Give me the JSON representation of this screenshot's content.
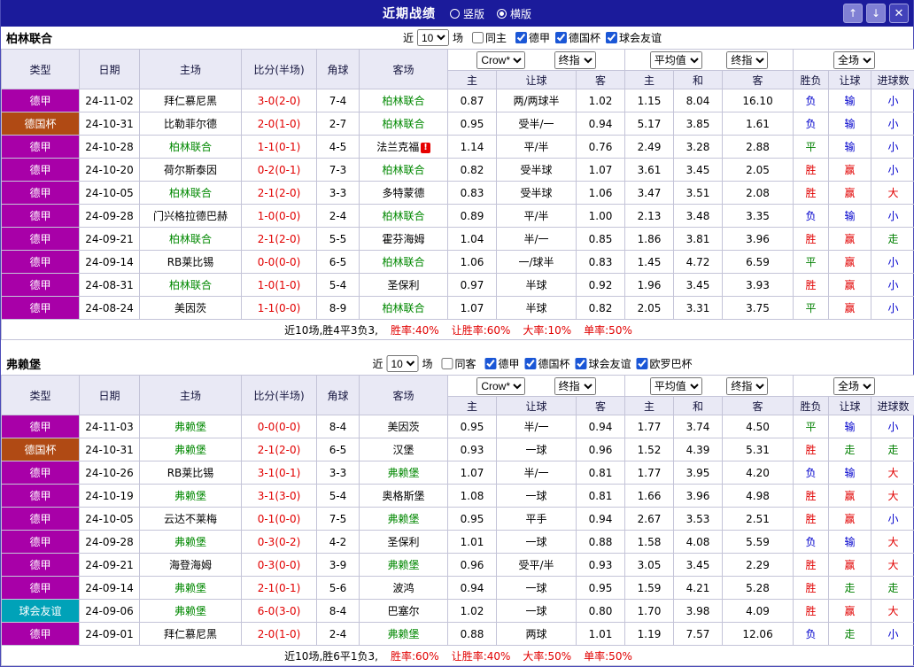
{
  "topbar": {
    "title": "近期战绩",
    "view_options": [
      {
        "label": "竖版",
        "selected": false
      },
      {
        "label": "横版",
        "selected": true
      }
    ],
    "background": "#1b1b9b"
  },
  "icons": {
    "up-icon": "↑",
    "down-icon": "↓",
    "close-icon": "✕",
    "alert-icon": "!"
  },
  "columns": [
    "类型",
    "日期",
    "主场",
    "比分(半场)",
    "角球",
    "客场",
    "主",
    "让球",
    "客",
    "主",
    "和",
    "客",
    "胜负",
    "让球",
    "进球数"
  ],
  "selects": {
    "handicap_company": "Crow*",
    "handicap_final": "终指",
    "euro_company": "平均值",
    "euro_final": "终指",
    "scope": "全场"
  },
  "league_colors": {
    "德甲": "#a800a8",
    "德国杯": "#b04a14",
    "球会友谊": "#00a2b8"
  },
  "result_colors": {
    "胜": "#e10000",
    "赢": "#e10000",
    "大": "#e10000",
    "负": "#0000cc",
    "输": "#0000cc",
    "小": "#0000cc",
    "平": "#008000",
    "走": "#008000"
  },
  "focus_color": "#008800",
  "score_color": "#e10000",
  "sections": [
    {
      "team": "柏林联合",
      "filter": {
        "near": "近",
        "count": "10",
        "unit": "场",
        "same": "同主",
        "leagues": [
          "德甲",
          "德国杯",
          "球会友谊"
        ]
      },
      "summary": {
        "prefix": "近10场,胜4平3负3,",
        "stats": [
          "胜率:40%",
          "让胜率:60%",
          "大率:10%",
          "单率:50%"
        ]
      },
      "rows": [
        {
          "league": "德甲",
          "date": "24-11-02",
          "home": "拜仁慕尼黑",
          "home_focus": false,
          "score": "3-0(2-0)",
          "corner": "7-4",
          "away": "柏林联合",
          "away_focus": true,
          "ah_home": "0.87",
          "handicap": "两/两球半",
          "ah_away": "1.02",
          "eu_home": "1.15",
          "eu_draw": "8.04",
          "eu_away": "16.10",
          "outcome": "负",
          "handicap_result": "输",
          "goals_result": "小"
        },
        {
          "league": "德国杯",
          "date": "24-10-31",
          "home": "比勒菲尔德",
          "home_focus": false,
          "score": "2-0(1-0)",
          "corner": "2-7",
          "away": "柏林联合",
          "away_focus": true,
          "ah_home": "0.95",
          "handicap": "受半/一",
          "ah_away": "0.94",
          "eu_home": "5.17",
          "eu_draw": "3.85",
          "eu_away": "1.61",
          "outcome": "负",
          "handicap_result": "输",
          "goals_result": "小"
        },
        {
          "league": "德甲",
          "date": "24-10-28",
          "home": "柏林联合",
          "home_focus": true,
          "score": "1-1(0-1)",
          "corner": "4-5",
          "away": "法兰克福",
          "away_focus": false,
          "away_alert": true,
          "ah_home": "1.14",
          "handicap": "平/半",
          "ah_away": "0.76",
          "eu_home": "2.49",
          "eu_draw": "3.28",
          "eu_away": "2.88",
          "outcome": "平",
          "handicap_result": "输",
          "goals_result": "小"
        },
        {
          "league": "德甲",
          "date": "24-10-20",
          "home": "荷尔斯泰因",
          "home_focus": false,
          "score": "0-2(0-1)",
          "corner": "7-3",
          "away": "柏林联合",
          "away_focus": true,
          "ah_home": "0.82",
          "handicap": "受半球",
          "ah_away": "1.07",
          "eu_home": "3.61",
          "eu_draw": "3.45",
          "eu_away": "2.05",
          "outcome": "胜",
          "handicap_result": "赢",
          "goals_result": "小"
        },
        {
          "league": "德甲",
          "date": "24-10-05",
          "home": "柏林联合",
          "home_focus": true,
          "score": "2-1(2-0)",
          "corner": "3-3",
          "away": "多特蒙德",
          "away_focus": false,
          "ah_home": "0.83",
          "handicap": "受半球",
          "ah_away": "1.06",
          "eu_home": "3.47",
          "eu_draw": "3.51",
          "eu_away": "2.08",
          "outcome": "胜",
          "handicap_result": "赢",
          "goals_result": "大"
        },
        {
          "league": "德甲",
          "date": "24-09-28",
          "home": "门兴格拉德巴赫",
          "home_focus": false,
          "score": "1-0(0-0)",
          "corner": "2-4",
          "away": "柏林联合",
          "away_focus": true,
          "ah_home": "0.89",
          "handicap": "平/半",
          "ah_away": "1.00",
          "eu_home": "2.13",
          "eu_draw": "3.48",
          "eu_away": "3.35",
          "outcome": "负",
          "handicap_result": "输",
          "goals_result": "小"
        },
        {
          "league": "德甲",
          "date": "24-09-21",
          "home": "柏林联合",
          "home_focus": true,
          "score": "2-1(2-0)",
          "corner": "5-5",
          "away": "霍芬海姆",
          "away_focus": false,
          "ah_home": "1.04",
          "handicap": "半/一",
          "ah_away": "0.85",
          "eu_home": "1.86",
          "eu_draw": "3.81",
          "eu_away": "3.96",
          "outcome": "胜",
          "handicap_result": "赢",
          "goals_result": "走"
        },
        {
          "league": "德甲",
          "date": "24-09-14",
          "home": "RB莱比锡",
          "home_focus": false,
          "score": "0-0(0-0)",
          "corner": "6-5",
          "away": "柏林联合",
          "away_focus": true,
          "ah_home": "1.06",
          "handicap": "一/球半",
          "ah_away": "0.83",
          "eu_home": "1.45",
          "eu_draw": "4.72",
          "eu_away": "6.59",
          "outcome": "平",
          "handicap_result": "赢",
          "goals_result": "小"
        },
        {
          "league": "德甲",
          "date": "24-08-31",
          "home": "柏林联合",
          "home_focus": true,
          "score": "1-0(1-0)",
          "corner": "5-4",
          "away": "圣保利",
          "away_focus": false,
          "ah_home": "0.97",
          "handicap": "半球",
          "ah_away": "0.92",
          "eu_home": "1.96",
          "eu_draw": "3.45",
          "eu_away": "3.93",
          "outcome": "胜",
          "handicap_result": "赢",
          "goals_result": "小"
        },
        {
          "league": "德甲",
          "date": "24-08-24",
          "home": "美因茨",
          "home_focus": false,
          "score": "1-1(0-0)",
          "corner": "8-9",
          "away": "柏林联合",
          "away_focus": true,
          "ah_home": "1.07",
          "handicap": "半球",
          "ah_away": "0.82",
          "eu_home": "2.05",
          "eu_draw": "3.31",
          "eu_away": "3.75",
          "outcome": "平",
          "handicap_result": "赢",
          "goals_result": "小"
        }
      ]
    },
    {
      "team": "弗赖堡",
      "filter": {
        "near": "近",
        "count": "10",
        "unit": "场",
        "same": "同客",
        "leagues": [
          "德甲",
          "德国杯",
          "球会友谊",
          "欧罗巴杯"
        ]
      },
      "summary": {
        "prefix": "近10场,胜6平1负3,",
        "stats": [
          "胜率:60%",
          "让胜率:40%",
          "大率:50%",
          "单率:50%"
        ]
      },
      "rows": [
        {
          "league": "德甲",
          "date": "24-11-03",
          "home": "弗赖堡",
          "home_focus": true,
          "score": "0-0(0-0)",
          "corner": "8-4",
          "away": "美因茨",
          "away_focus": false,
          "ah_home": "0.95",
          "handicap": "半/一",
          "ah_away": "0.94",
          "eu_home": "1.77",
          "eu_draw": "3.74",
          "eu_away": "4.50",
          "outcome": "平",
          "handicap_result": "输",
          "goals_result": "小"
        },
        {
          "league": "德国杯",
          "date": "24-10-31",
          "home": "弗赖堡",
          "home_focus": true,
          "score": "2-1(2-0)",
          "corner": "6-5",
          "away": "汉堡",
          "away_focus": false,
          "ah_home": "0.93",
          "handicap": "一球",
          "ah_away": "0.96",
          "eu_home": "1.52",
          "eu_draw": "4.39",
          "eu_away": "5.31",
          "outcome": "胜",
          "handicap_result": "走",
          "goals_result": "走"
        },
        {
          "league": "德甲",
          "date": "24-10-26",
          "home": "RB莱比锡",
          "home_focus": false,
          "score": "3-1(0-1)",
          "corner": "3-3",
          "away": "弗赖堡",
          "away_focus": true,
          "ah_home": "1.07",
          "handicap": "半/一",
          "ah_away": "0.81",
          "eu_home": "1.77",
          "eu_draw": "3.95",
          "eu_away": "4.20",
          "outcome": "负",
          "handicap_result": "输",
          "goals_result": "大"
        },
        {
          "league": "德甲",
          "date": "24-10-19",
          "home": "弗赖堡",
          "home_focus": true,
          "score": "3-1(3-0)",
          "corner": "5-4",
          "away": "奥格斯堡",
          "away_focus": false,
          "ah_home": "1.08",
          "handicap": "一球",
          "ah_away": "0.81",
          "eu_home": "1.66",
          "eu_draw": "3.96",
          "eu_away": "4.98",
          "outcome": "胜",
          "handicap_result": "赢",
          "goals_result": "大"
        },
        {
          "league": "德甲",
          "date": "24-10-05",
          "home": "云达不莱梅",
          "home_focus": false,
          "score": "0-1(0-0)",
          "corner": "7-5",
          "away": "弗赖堡",
          "away_focus": true,
          "ah_home": "0.95",
          "handicap": "平手",
          "ah_away": "0.94",
          "eu_home": "2.67",
          "eu_draw": "3.53",
          "eu_away": "2.51",
          "outcome": "胜",
          "handicap_result": "赢",
          "goals_result": "小"
        },
        {
          "league": "德甲",
          "date": "24-09-28",
          "home": "弗赖堡",
          "home_focus": true,
          "score": "0-3(0-2)",
          "corner": "4-2",
          "away": "圣保利",
          "away_focus": false,
          "ah_home": "1.01",
          "handicap": "一球",
          "ah_away": "0.88",
          "eu_home": "1.58",
          "eu_draw": "4.08",
          "eu_away": "5.59",
          "outcome": "负",
          "handicap_result": "输",
          "goals_result": "大"
        },
        {
          "league": "德甲",
          "date": "24-09-21",
          "home": "海登海姆",
          "home_focus": false,
          "score": "0-3(0-0)",
          "corner": "3-9",
          "away": "弗赖堡",
          "away_focus": true,
          "ah_home": "0.96",
          "handicap": "受平/半",
          "ah_away": "0.93",
          "eu_home": "3.05",
          "eu_draw": "3.45",
          "eu_away": "2.29",
          "outcome": "胜",
          "handicap_result": "赢",
          "goals_result": "大"
        },
        {
          "league": "德甲",
          "date": "24-09-14",
          "home": "弗赖堡",
          "home_focus": true,
          "score": "2-1(0-1)",
          "corner": "5-6",
          "away": "波鸿",
          "away_focus": false,
          "ah_home": "0.94",
          "handicap": "一球",
          "ah_away": "0.95",
          "eu_home": "1.59",
          "eu_draw": "4.21",
          "eu_away": "5.28",
          "outcome": "胜",
          "handicap_result": "走",
          "goals_result": "走"
        },
        {
          "league": "球会友谊",
          "date": "24-09-06",
          "home": "弗赖堡",
          "home_focus": true,
          "score": "6-0(3-0)",
          "corner": "8-4",
          "away": "巴塞尔",
          "away_focus": false,
          "ah_home": "1.02",
          "handicap": "一球",
          "ah_away": "0.80",
          "eu_home": "1.70",
          "eu_draw": "3.98",
          "eu_away": "4.09",
          "outcome": "胜",
          "handicap_result": "赢",
          "goals_result": "大"
        },
        {
          "league": "德甲",
          "date": "24-09-01",
          "home": "拜仁慕尼黑",
          "home_focus": false,
          "score": "2-0(1-0)",
          "corner": "2-4",
          "away": "弗赖堡",
          "away_focus": true,
          "ah_home": "0.88",
          "handicap": "两球",
          "ah_away": "1.01",
          "eu_home": "1.19",
          "eu_draw": "7.57",
          "eu_away": "12.06",
          "outcome": "负",
          "handicap_result": "走",
          "goals_result": "小"
        }
      ]
    }
  ]
}
